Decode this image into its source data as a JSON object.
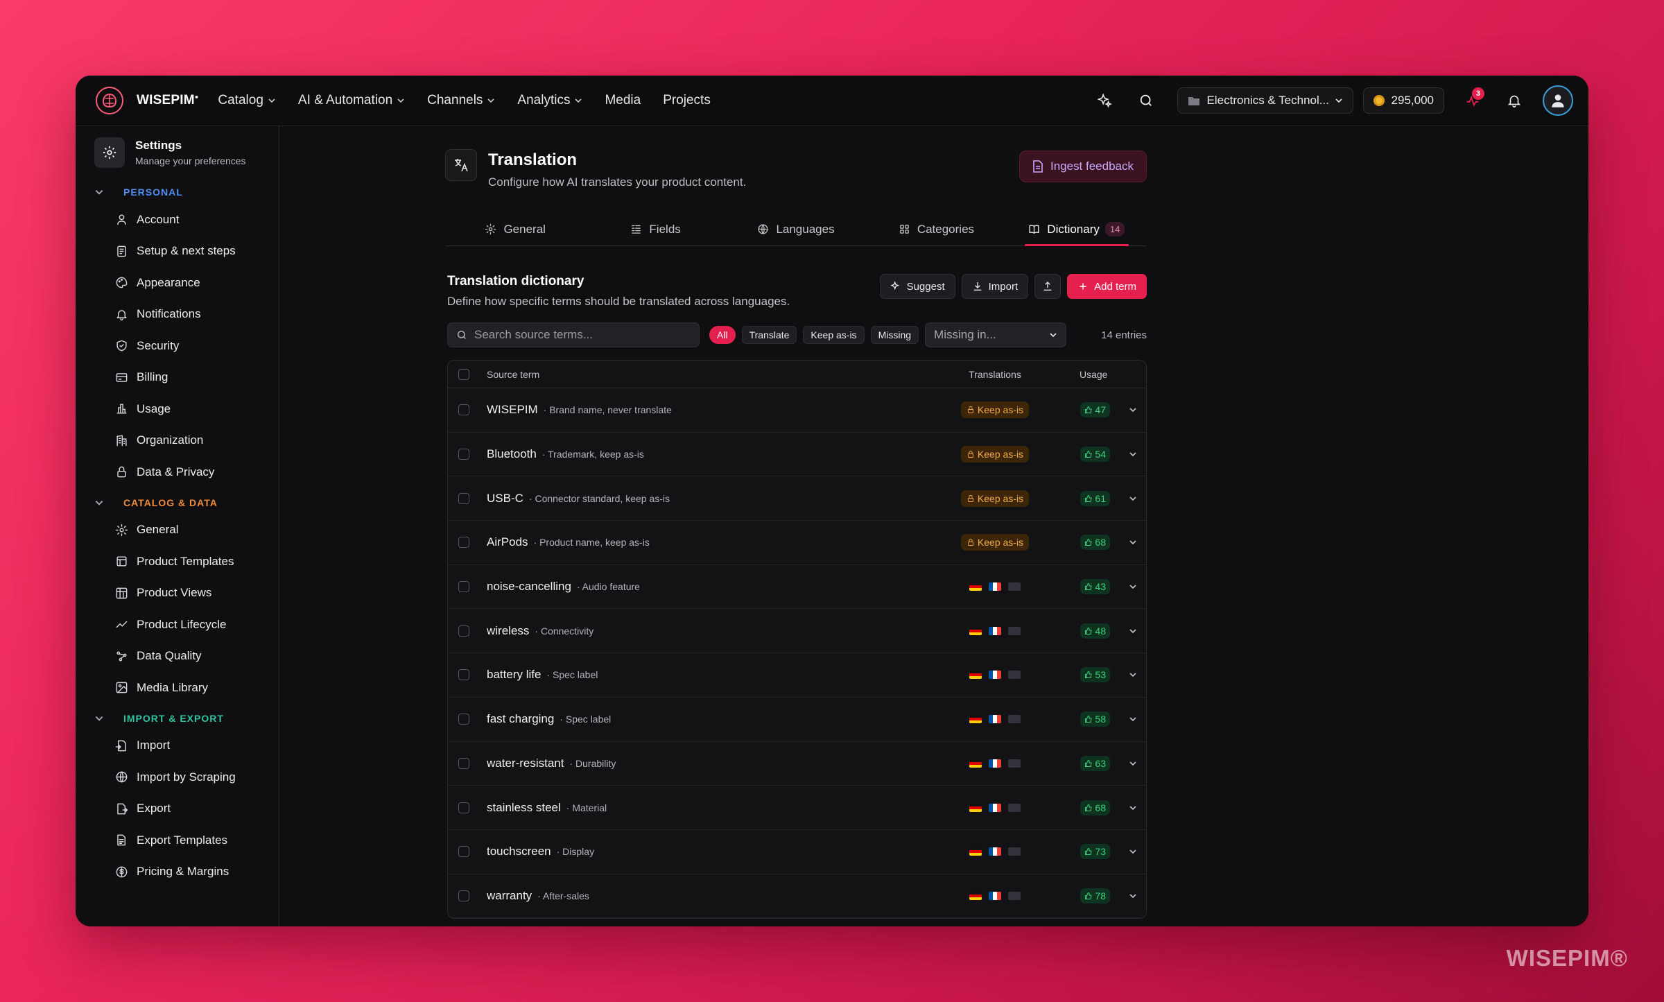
{
  "brand": "WISEPIM",
  "watermark": "WISEPIM®",
  "nav": {
    "items": [
      {
        "label": "Catalog",
        "has_chevron": true
      },
      {
        "label": "AI & Automation",
        "has_chevron": true
      },
      {
        "label": "Channels",
        "has_chevron": true
      },
      {
        "label": "Analytics",
        "has_chevron": true
      },
      {
        "label": "Media",
        "has_chevron": false
      },
      {
        "label": "Projects",
        "has_chevron": false
      }
    ],
    "workspace": "Electronics & Technol...",
    "credits": "295,000",
    "notification_count": "3"
  },
  "sidebar": {
    "title": "Settings",
    "subtitle": "Manage your preferences",
    "sections": [
      {
        "label": "PERSONAL",
        "color": "#4f8ef7",
        "items": [
          {
            "label": "Account",
            "icon": "user-icon"
          },
          {
            "label": "Setup & next steps",
            "icon": "checklist-icon"
          },
          {
            "label": "Appearance",
            "icon": "palette-icon"
          },
          {
            "label": "Notifications",
            "icon": "bell-icon"
          },
          {
            "label": "Security",
            "icon": "shield-icon"
          },
          {
            "label": "Billing",
            "icon": "credit-card-icon"
          },
          {
            "label": "Usage",
            "icon": "bar-chart-icon"
          },
          {
            "label": "Organization",
            "icon": "building-icon"
          },
          {
            "label": "Data & Privacy",
            "icon": "lock-icon"
          }
        ]
      },
      {
        "label": "CATALOG & DATA",
        "color": "#f08a3c",
        "items": [
          {
            "label": "General",
            "icon": "gear-icon"
          },
          {
            "label": "Product Templates",
            "icon": "template-icon"
          },
          {
            "label": "Product Views",
            "icon": "table-icon"
          },
          {
            "label": "Product Lifecycle",
            "icon": "trend-icon"
          },
          {
            "label": "Data Quality",
            "icon": "sparkle-icon"
          },
          {
            "label": "Media Library",
            "icon": "image-icon"
          }
        ]
      },
      {
        "label": "IMPORT & EXPORT",
        "color": "#2fc4a0",
        "items": [
          {
            "label": "Import",
            "icon": "file-import-icon"
          },
          {
            "label": "Import by Scraping",
            "icon": "globe-icon"
          },
          {
            "label": "Export",
            "icon": "file-export-icon"
          },
          {
            "label": "Export Templates",
            "icon": "file-template-icon"
          },
          {
            "label": "Pricing & Margins",
            "icon": "dollar-icon"
          }
        ]
      }
    ]
  },
  "page": {
    "title": "Translation",
    "subtitle": "Configure how AI translates your product content.",
    "ingest_label": "Ingest feedback",
    "tabs": [
      {
        "label": "General",
        "icon": "gear-icon"
      },
      {
        "label": "Fields",
        "icon": "fields-icon"
      },
      {
        "label": "Languages",
        "icon": "globe-icon"
      },
      {
        "label": "Categories",
        "icon": "grid-icon"
      },
      {
        "label": "Dictionary",
        "icon": "book-icon",
        "count": "14",
        "active": true
      }
    ]
  },
  "dictionary": {
    "title": "Translation dictionary",
    "subtitle": "Define how specific terms should be translated across languages.",
    "suggest_label": "Suggest",
    "import_label": "Import",
    "add_label": "Add term",
    "search_placeholder": "Search source terms...",
    "filters": [
      "All",
      "Translate",
      "Keep as-is",
      "Missing"
    ],
    "missing_placeholder": "Missing in...",
    "entries_label": "14 entries",
    "columns": {
      "source": "Source term",
      "translations": "Translations",
      "usage": "Usage"
    },
    "rows": [
      {
        "term": "WISEPIM",
        "note": "· Brand name, never translate",
        "keep": "Keep as-is",
        "usage": "47"
      },
      {
        "term": "Bluetooth",
        "note": "· Trademark, keep as-is",
        "keep": "Keep as-is",
        "usage": "54"
      },
      {
        "term": "USB-C",
        "note": "· Connector standard, keep as-is",
        "keep": "Keep as-is",
        "usage": "61"
      },
      {
        "term": "AirPods",
        "note": "· Product name, keep as-is",
        "keep": "Keep as-is",
        "usage": "68"
      },
      {
        "term": "noise-cancelling",
        "note": "· Audio feature",
        "keep": "",
        "usage": "43"
      },
      {
        "term": "wireless",
        "note": "· Connectivity",
        "keep": "",
        "usage": "48"
      },
      {
        "term": "battery life",
        "note": "· Spec label",
        "keep": "",
        "usage": "53"
      },
      {
        "term": "fast charging",
        "note": "· Spec label",
        "keep": "",
        "usage": "58"
      },
      {
        "term": "water-resistant",
        "note": "· Durability",
        "keep": "",
        "usage": "63"
      },
      {
        "term": "stainless steel",
        "note": "· Material",
        "keep": "",
        "usage": "68"
      },
      {
        "term": "touchscreen",
        "note": "· Display",
        "keep": "",
        "usage": "73"
      },
      {
        "term": "warranty",
        "note": "· After-sales",
        "keep": "",
        "usage": "78"
      }
    ]
  },
  "colors": {
    "accent": "#e5204f",
    "keep_bg": "#3d2608",
    "keep_fg": "#f1a94a",
    "usage_fg": "#3fd07a"
  }
}
